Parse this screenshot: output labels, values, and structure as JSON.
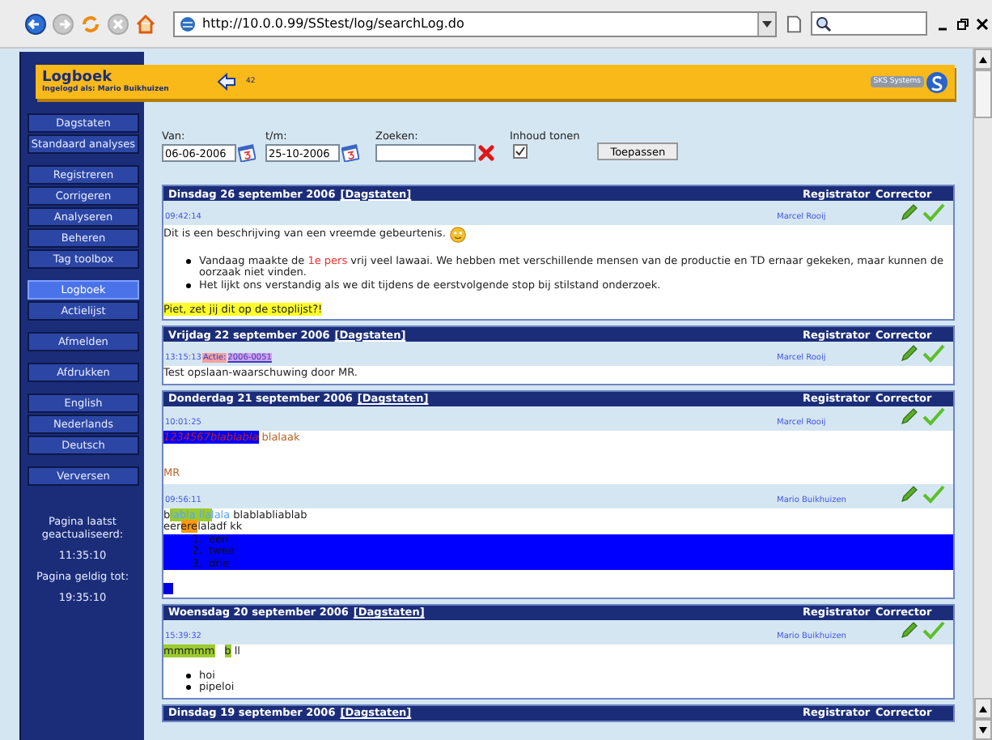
{
  "browser": {
    "address": "http://10.0.0.99/SStest/log/searchLog.do"
  },
  "header": {
    "title": "Logboek",
    "subtitle": "Ingelogd als: Mario Buikhuizen",
    "count": "42",
    "logo": "SKS Systems"
  },
  "sidebar": {
    "groups": [
      [
        {
          "label": "Dagstaten",
          "selected": false
        },
        {
          "label": "Standaard analyses",
          "selected": false
        }
      ],
      [
        {
          "label": "Registreren",
          "selected": false
        },
        {
          "label": "Corrigeren",
          "selected": false
        },
        {
          "label": "Analyseren",
          "selected": false
        },
        {
          "label": "Beheren",
          "selected": false
        },
        {
          "label": "Tag toolbox",
          "selected": false
        }
      ],
      [
        {
          "label": "Logboek",
          "selected": true
        },
        {
          "label": "Actielijst",
          "selected": false
        }
      ],
      [
        {
          "label": "Afmelden",
          "selected": false
        }
      ],
      [
        {
          "label": "Afdrukken",
          "selected": false
        }
      ],
      [
        {
          "label": "English",
          "selected": false
        },
        {
          "label": "Nederlands",
          "selected": false
        },
        {
          "label": "Deutsch",
          "selected": false
        }
      ],
      [
        {
          "label": "Verversen",
          "selected": false
        }
      ]
    ],
    "info": [
      "Pagina laatst geactualiseerd:",
      "11:35:10",
      "Pagina geldig tot:",
      "19:35:10"
    ]
  },
  "filters": {
    "from_label": "Van:",
    "from": "06-06-2006",
    "to_label": "t/m:",
    "to": "25-10-2006",
    "search_label": "Zoeken:",
    "content_label": "Inhoud tonen",
    "content_checked": true,
    "apply": "Toepassen"
  },
  "days": [
    {
      "date": "Dinsdag 26 september 2006",
      "link": "[Dagstaten]",
      "col_registrator": "Registrator",
      "col_corrector": "Corrector",
      "records": [
        {
          "time": "09:42:14",
          "registrator": "Marcel Rooij",
          "blocks": [
            {
              "kind": "paragraph",
              "smiley": true,
              "segments": [
                {
                  "kind": "plain",
                  "text": "Dit is een beschrijving van een vreemde gebeurtenis."
                }
              ]
            },
            {
              "kind": "blank"
            },
            {
              "kind": "bullets",
              "items": [
                [
                  {
                    "kind": "plain",
                    "text": "Vandaag maakte de "
                  },
                  {
                    "kind": "red",
                    "text": "1e pers"
                  },
                  {
                    "kind": "plain",
                    "text": " vrij veel lawaai. We hebben met verschillende mensen van de productie en TD ernaar gekeken, maar kunnen de oorzaak niet vinden."
                  }
                ],
                [
                  {
                    "kind": "plain",
                    "text": "Het lijkt ons verstandig als we dit tijdens de eerstvolgende stop bij stilstand onderzoek."
                  }
                ]
              ]
            },
            {
              "kind": "blank"
            },
            {
              "kind": "paragraph",
              "segments": [
                {
                  "kind": "mark-yellow",
                  "text": "Piet, zet jij dit op de stoplijst?!"
                }
              ]
            }
          ]
        }
      ]
    },
    {
      "date": "Vrijdag 22 september 2006",
      "link": "[Dagstaten]",
      "col_registrator": "Registrator",
      "col_corrector": "Corrector",
      "records": [
        {
          "time": "13:15:13",
          "tags": [
            {
              "kind": "label",
              "text": "Actie:"
            },
            {
              "kind": "link",
              "text": "2006-0051"
            }
          ],
          "registrator": "Marcel Rooij",
          "blocks": [
            {
              "kind": "paragraph",
              "segments": [
                {
                  "kind": "plain",
                  "text": "Test opslaan-waarschuwing door MR."
                }
              ]
            }
          ]
        }
      ]
    },
    {
      "date": "Donderdag 21 september 2006",
      "link": "[Dagstaten]",
      "col_registrator": "Registrator",
      "col_corrector": "Corrector",
      "records": [
        {
          "time": "10:01:25",
          "registrator": "Marcel Rooij",
          "blocks": [
            {
              "kind": "paragraph",
              "segments": [
                {
                  "kind": "mark-blue",
                  "text": "1234567blablabla"
                },
                {
                  "kind": "brown",
                  "text": " blalaak"
                }
              ]
            },
            {
              "kind": "blank"
            },
            {
              "kind": "blank"
            },
            {
              "kind": "paragraph",
              "segments": [
                {
                  "kind": "brown",
                  "text": "MR"
                }
              ]
            }
          ]
        },
        {
          "time": "09:56:11",
          "registrator": "Mario Buikhuizen",
          "blocks": [
            {
              "kind": "paragraph",
              "segments": [
                {
                  "kind": "plain",
                  "text": "b"
                },
                {
                  "kind": "mark-green-light",
                  "text": "labla lla"
                },
                {
                  "kind": "light",
                  "text": "lala"
                },
                {
                  "kind": "plain",
                  "text": "  blablabliablab"
                }
              ]
            },
            {
              "kind": "paragraph",
              "segments": [
                {
                  "kind": "plain",
                  "text": "eer"
                },
                {
                  "kind": "mark-orange",
                  "text": "ere"
                },
                {
                  "kind": "plain",
                  "text": "laladf kk"
                }
              ]
            },
            {
              "kind": "numbered",
              "highlighted": true,
              "items": [
                [
                  {
                    "kind": "number",
                    "text": "1."
                  },
                  {
                    "kind": "plain",
                    "text": "een"
                  }
                ],
                [
                  {
                    "kind": "number",
                    "text": "2."
                  },
                  {
                    "kind": "plain",
                    "text": "twee"
                  }
                ],
                [
                  {
                    "kind": "number",
                    "text": "3."
                  },
                  {
                    "kind": "plain",
                    "text": "drie"
                  }
                ]
              ]
            },
            {
              "kind": "blank"
            },
            {
              "kind": "blue-square"
            }
          ]
        }
      ]
    },
    {
      "date": "Woensdag 20 september 2006",
      "link": "[Dagstaten]",
      "col_registrator": "Registrator",
      "col_corrector": "Corrector",
      "records": [
        {
          "time": "15:39:32",
          "registrator": "Mario Buikhuizen",
          "blocks": [
            {
              "kind": "paragraph",
              "segments": [
                {
                  "kind": "mark-green",
                  "text": "mmmmm"
                },
                {
                  "kind": "mark-green-gap",
                  "text": "b"
                },
                {
                  "kind": "plain",
                  "text": " ll"
                }
              ]
            },
            {
              "kind": "blank"
            },
            {
              "kind": "bullets",
              "items": [
                [
                  {
                    "kind": "plain",
                    "text": "hoi"
                  }
                ],
                [
                  {
                    "kind": "plain",
                    "text": "pipeloi"
                  }
                ]
              ]
            }
          ]
        }
      ]
    },
    {
      "date": "Dinsdag 19 september 2006",
      "link": "[Dagstaten]",
      "col_registrator": "Registrator",
      "col_corrector": "Corrector"
    }
  ]
}
